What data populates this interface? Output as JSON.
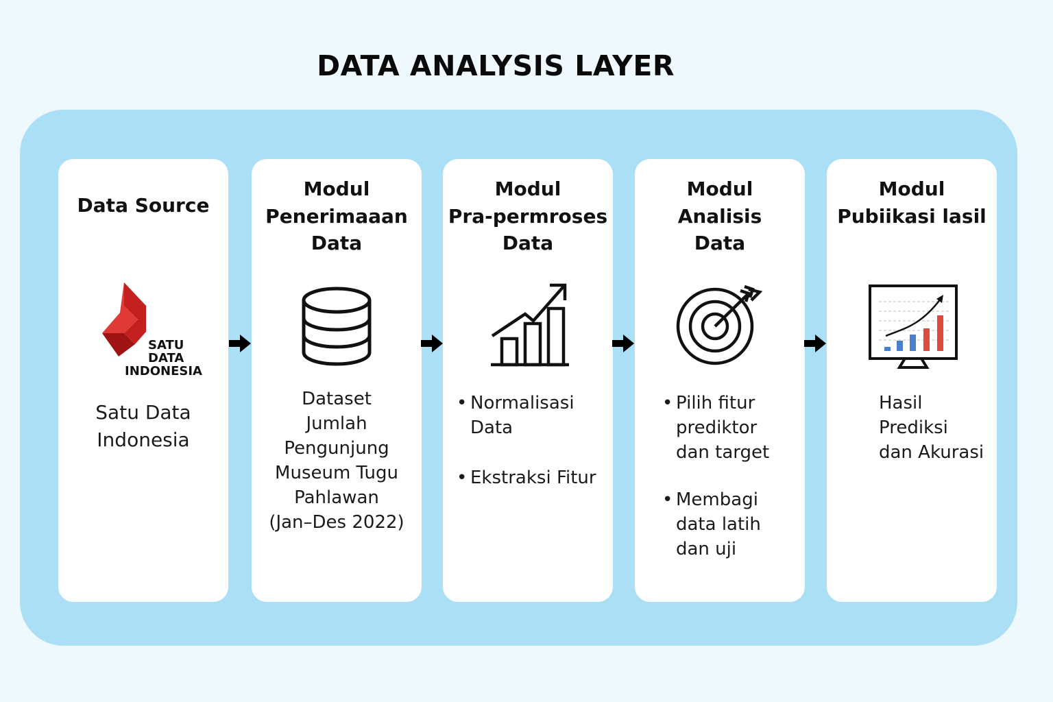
{
  "title": "DATA ANALYSIS LAYER",
  "cards": [
    {
      "title_lines": [
        "Data Source"
      ],
      "logo_text": [
        "SATU",
        "DATA",
        "INDONESIA"
      ],
      "body_lines": [
        "Satu Data",
        "Indonesia"
      ]
    },
    {
      "title_lines": [
        "Modul",
        "Penerimaaan",
        "Data"
      ],
      "icon": "database-icon",
      "body_lines": [
        "Dataset",
        "Jumlah",
        "Pengunjung",
        "Museum Tugu",
        "Pahlawan",
        "(Jan–Des 2022)"
      ]
    },
    {
      "title_lines": [
        "Modul",
        "Pra-permroses",
        "Data"
      ],
      "icon": "growth-chart-icon",
      "bullets": [
        [
          "Normalisasi",
          "Data"
        ],
        [
          "Ekstraksi Fitur"
        ]
      ]
    },
    {
      "title_lines": [
        "Modul",
        "Analisis",
        "Data"
      ],
      "icon": "target-icon",
      "bullets": [
        [
          "Pilih fitur",
          "prediktor",
          "dan target"
        ],
        [
          "Membagi",
          "data latih",
          "dan uji"
        ]
      ]
    },
    {
      "title_lines": [
        "Modul",
        "Pubiikasi lasil"
      ],
      "icon": "monitor-chart-icon",
      "body_lines": [
        "Hasil",
        "Prediksi",
        "dan Akurasi"
      ]
    }
  ],
  "colors": {
    "background": "#eef8fd",
    "panel": "#abdff6",
    "card": "#ffffff",
    "logo_red": "#d42a2a",
    "bar_blue": "#4a7fd0",
    "bar_red": "#e04a3c"
  }
}
